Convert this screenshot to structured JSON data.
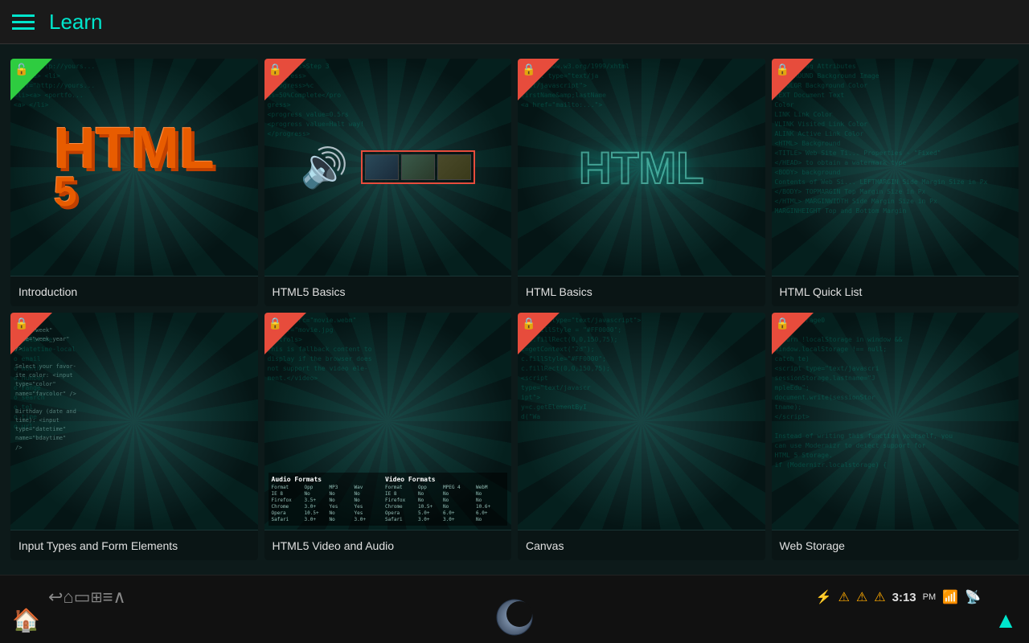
{
  "header": {
    "title": "Learn",
    "menu_label": "menu"
  },
  "cards": [
    {
      "id": "intro",
      "label": "Introduction",
      "lock_color": "green",
      "locked": false
    },
    {
      "id": "html5basics",
      "label": "HTML5 Basics",
      "lock_color": "red",
      "locked": true
    },
    {
      "id": "htmlbasics",
      "label": "HTML Basics",
      "lock_color": "red",
      "locked": true
    },
    {
      "id": "quicklist",
      "label": "HTML Quick List",
      "lock_color": "red",
      "locked": true
    },
    {
      "id": "inputtypes",
      "label": "Input Types and Form Elements",
      "lock_color": "red",
      "locked": true
    },
    {
      "id": "videoaudio",
      "label": "HTML5 Video and Audio",
      "lock_color": "red",
      "locked": true
    },
    {
      "id": "canvas",
      "label": "Canvas",
      "lock_color": "red",
      "locked": true
    },
    {
      "id": "webstorage",
      "label": "Web Storage",
      "lock_color": "red",
      "locked": true
    }
  ],
  "nav": {
    "home_label": "home",
    "back_label": "back",
    "recents_label": "recents",
    "qr_label": "qr",
    "menu_label": "menu",
    "up_label": "up"
  },
  "statusbar": {
    "time": "3:13",
    "ampm": "PM"
  }
}
